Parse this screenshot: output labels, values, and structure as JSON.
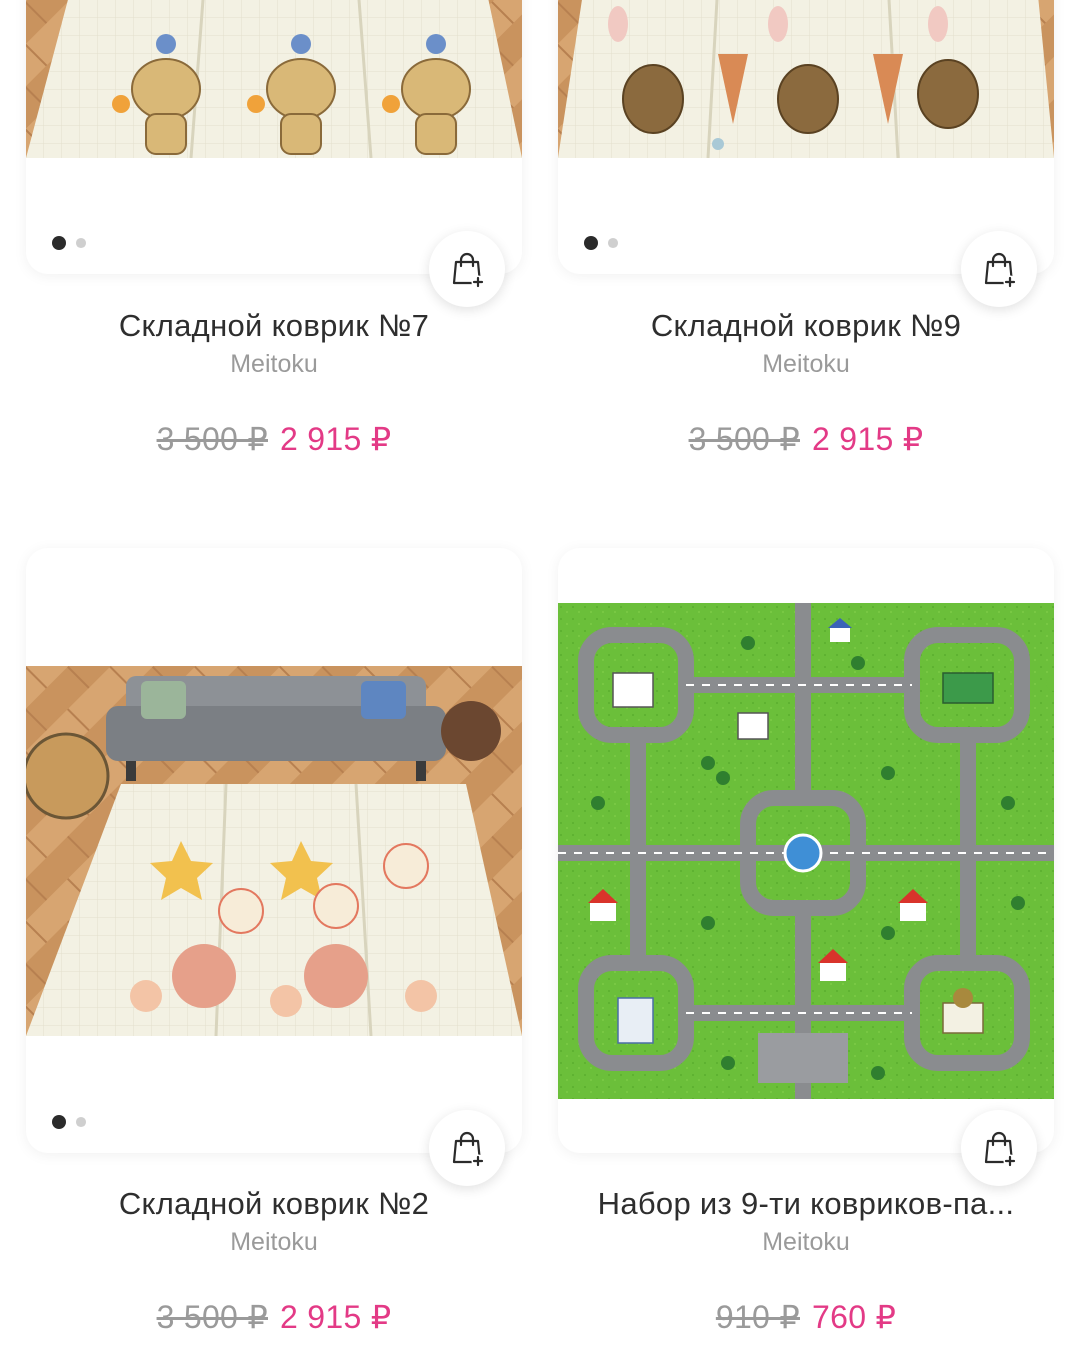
{
  "colors": {
    "accent_price": "#e33a86",
    "old_price": "#9a9a9a",
    "title": "#2e2e2e",
    "dot_active": "#2b2b2b",
    "dot_inactive": "#cfcfcf"
  },
  "products": [
    {
      "title": "Складной коврик №7",
      "brand": "Meitoku",
      "old_price": "3 500 ₽",
      "price": "2 915 ₽",
      "image": "play-mat-animals-photo",
      "slide_count": 2,
      "active_slide": 1,
      "cart_icon": "shopping-bag-plus-icon"
    },
    {
      "title": "Складной коврик №9",
      "brand": "Meitoku",
      "old_price": "3 500 ₽",
      "price": "2 915 ₽",
      "image": "play-mat-bears-photo",
      "slide_count": 2,
      "active_slide": 1,
      "cart_icon": "shopping-bag-plus-icon"
    },
    {
      "title": "Складной коврик №2",
      "brand": "Meitoku",
      "old_price": "3 500 ₽",
      "price": "2 915 ₽",
      "image": "play-mat-living-room-photo",
      "slide_count": 2,
      "active_slide": 1,
      "cart_icon": "shopping-bag-plus-icon"
    },
    {
      "title": "Набор из 9-ти ковриков-па...",
      "brand": "Meitoku",
      "old_price": "910 ₽",
      "price": "760 ₽",
      "image": "puzzle-mat-city-map",
      "slide_count": 1,
      "active_slide": 1,
      "cart_icon": "shopping-bag-plus-icon"
    }
  ]
}
